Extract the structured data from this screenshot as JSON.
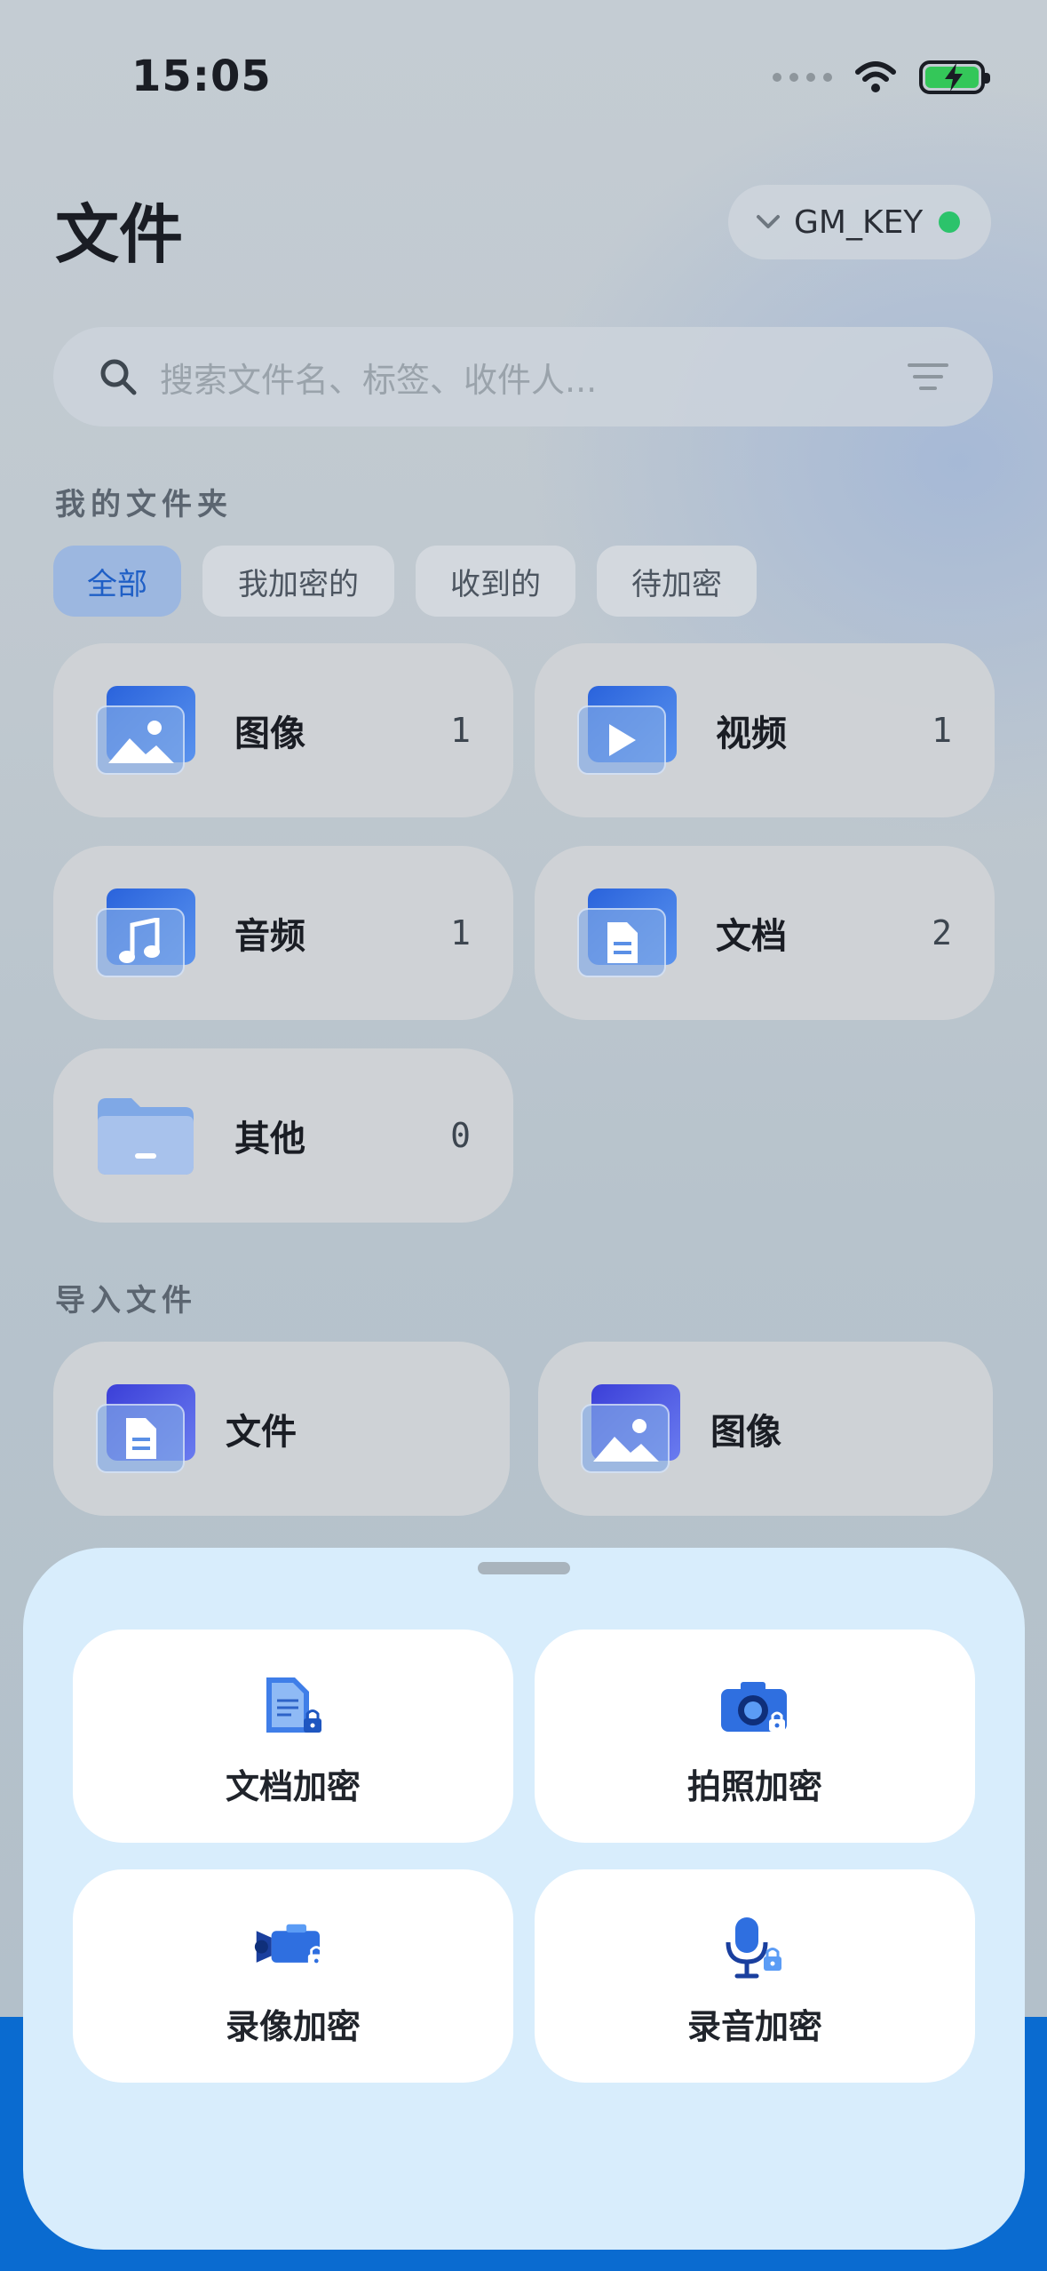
{
  "status_bar": {
    "time": "15:05"
  },
  "header": {
    "title": "文件",
    "key_name": "GM_KEY"
  },
  "search": {
    "placeholder": "搜索文件名、标签、收件人..."
  },
  "folders": {
    "section_label": "我的文件夹",
    "filters": [
      {
        "label": "全部",
        "active": true
      },
      {
        "label": "我加密的",
        "active": false
      },
      {
        "label": "收到的",
        "active": false
      },
      {
        "label": "待加密",
        "active": false
      }
    ],
    "items": [
      {
        "name": "图像",
        "count": "1",
        "icon": "image-icon"
      },
      {
        "name": "视频",
        "count": "1",
        "icon": "video-icon"
      },
      {
        "name": "音频",
        "count": "1",
        "icon": "music-icon"
      },
      {
        "name": "文档",
        "count": "2",
        "icon": "document-icon"
      },
      {
        "name": "其他",
        "count": "0",
        "icon": "folder-icon"
      }
    ]
  },
  "import": {
    "section_label": "导入文件",
    "items": [
      {
        "name": "文件",
        "icon": "document-icon"
      },
      {
        "name": "图像",
        "icon": "image-icon"
      }
    ]
  },
  "sheet": {
    "actions": [
      {
        "label": "文档加密",
        "icon": "encrypted-document-icon"
      },
      {
        "label": "拍照加密",
        "icon": "encrypted-camera-icon"
      },
      {
        "label": "录像加密",
        "icon": "encrypted-video-camera-icon"
      },
      {
        "label": "录音加密",
        "icon": "encrypted-microphone-icon"
      }
    ]
  },
  "colors": {
    "accent": "#2a63dc",
    "active_chip": "#9cb7e0",
    "online_dot": "#2cc36b",
    "sheet_bg": "#d8edfc",
    "bottom_bar": "#0a6bd0"
  }
}
